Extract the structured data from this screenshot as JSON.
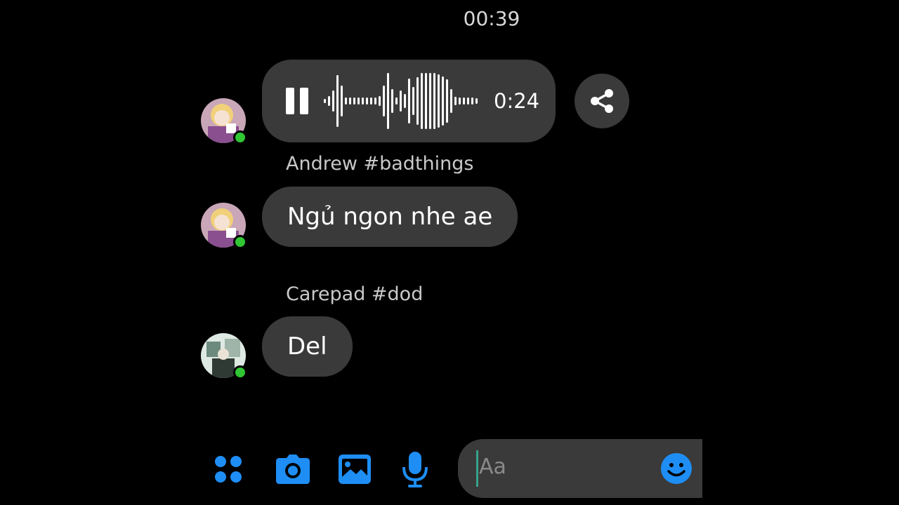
{
  "header": {
    "timestamp": "00:39"
  },
  "voice_message": {
    "duration": "0:24",
    "state_icon": "pause-icon"
  },
  "messages": [
    {
      "sender": "Andrew #badthings",
      "text": "Ngủ ngon nhe ae"
    },
    {
      "sender": "Carepad #dod",
      "text": "Del"
    }
  ],
  "composer": {
    "placeholder": "Aa"
  },
  "toolbar": {
    "icons": [
      "apps-icon",
      "camera-icon",
      "gallery-icon",
      "microphone-icon",
      "emoji-icon"
    ]
  },
  "colors": {
    "accent": "#1e8ef5",
    "bubble": "#3a3a3a",
    "online": "#31c633",
    "background": "#000000"
  }
}
